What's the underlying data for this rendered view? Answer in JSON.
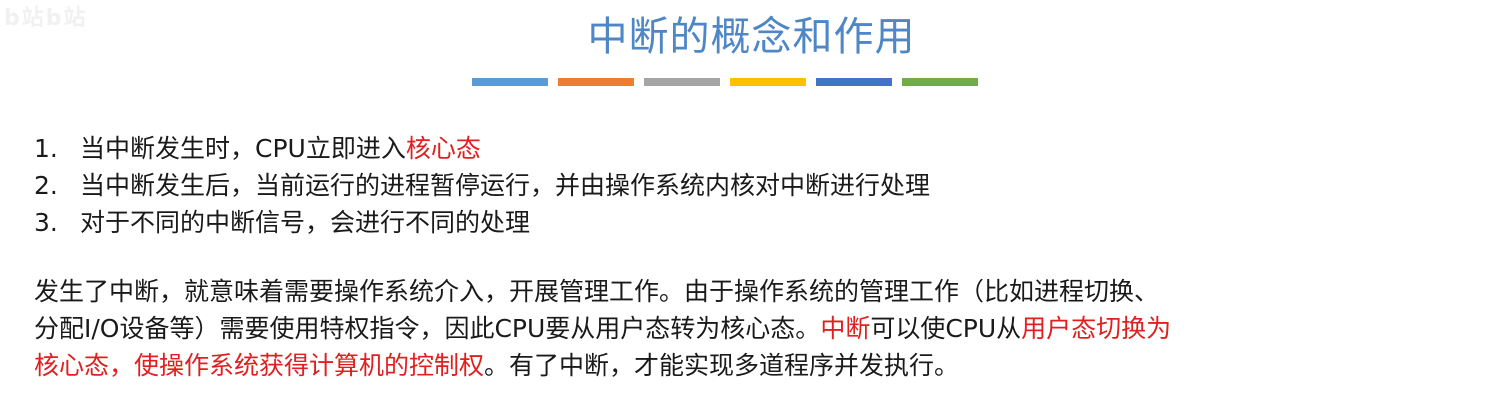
{
  "watermark": "b站b站",
  "title": "中断的概念和作用",
  "divider_colors": [
    "#5b9bd5",
    "#ed7d31",
    "#a5a5a5",
    "#ffc000",
    "#4472c4",
    "#70ad47"
  ],
  "list": [
    {
      "num": "1.",
      "text": "当中断发生时，CPU立即进入",
      "highlight": "核心态"
    },
    {
      "num": "2.",
      "text": "当中断发生后，当前运行的进程暂停运行，并由操作系统内核对中断进行处理"
    },
    {
      "num": "3.",
      "text": "对于不同的中断信号，会进行不同的处理"
    }
  ],
  "paragraph": {
    "line1": "发生了中断，就意味着需要操作系统介入，开展管理工作。由于操作系统的管理工作（比如进程切换、",
    "line2_a": "分配I/O设备等）需要使用特权指令，因此CPU要从用户态转为核心态。",
    "line2_b_red": "中断",
    "line2_c": "可以使CPU从",
    "line2_d_red": "用户态切换为",
    "line3_a_red": "核心态，使操作系统获得计算机的控制权",
    "line3_b": "。有了中断，才能实现多道程序并发执行。"
  }
}
